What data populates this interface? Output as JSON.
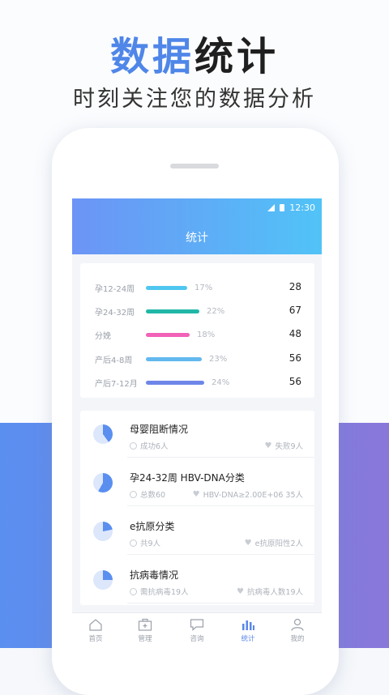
{
  "promo": {
    "headline_part1": "数据",
    "headline_part2": "统计",
    "subheadline": "时刻关注您的数据分析"
  },
  "status_bar": {
    "time": "12:30"
  },
  "screen": {
    "title": "统计"
  },
  "stats": [
    {
      "label": "孕12-24周",
      "percent": "17%",
      "value": "28",
      "color": "#4fc6ef",
      "fill": 0.17
    },
    {
      "label": "孕24-32周",
      "percent": "22%",
      "value": "67",
      "color": "#21b7a6",
      "fill": 0.22
    },
    {
      "label": "分娩",
      "percent": "18%",
      "value": "48",
      "color": "#f162b8",
      "fill": 0.18
    },
    {
      "label": "产后4-8周",
      "percent": "23%",
      "value": "56",
      "color": "#63b9ef",
      "fill": 0.23
    },
    {
      "label": "产后7-12月",
      "percent": "24%",
      "value": "56",
      "color": "#6d86e8",
      "fill": 0.24
    }
  ],
  "items": [
    {
      "title": "母婴阻断情况",
      "left_meta": "成功6人",
      "right_meta": "失败9人",
      "ratio": 0.4
    },
    {
      "title": "孕24-32周  HBV-DNA分类",
      "left_meta": "总数60",
      "right_meta": "HBV-DNA≥2.00E+06  35人",
      "ratio": 0.58
    },
    {
      "title": "e抗原分类",
      "left_meta": "共9人",
      "right_meta": "e抗原阳性2人",
      "ratio": 0.22
    },
    {
      "title": "抗病毒情况",
      "left_meta": "需抗病毒19人",
      "right_meta": "抗病毒人数19人",
      "ratio": 0.25
    }
  ],
  "tabs": [
    {
      "label": "首页",
      "icon": "home-icon"
    },
    {
      "label": "管理",
      "icon": "medkit-icon"
    },
    {
      "label": "咨询",
      "icon": "chat-icon"
    },
    {
      "label": "统计",
      "icon": "bar-chart-icon",
      "active": true
    },
    {
      "label": "我的",
      "icon": "user-icon"
    }
  ],
  "colors": {
    "accent": "#4f86e8",
    "pie": "#5a8ff0",
    "pie_bg": "#dde7fb"
  }
}
